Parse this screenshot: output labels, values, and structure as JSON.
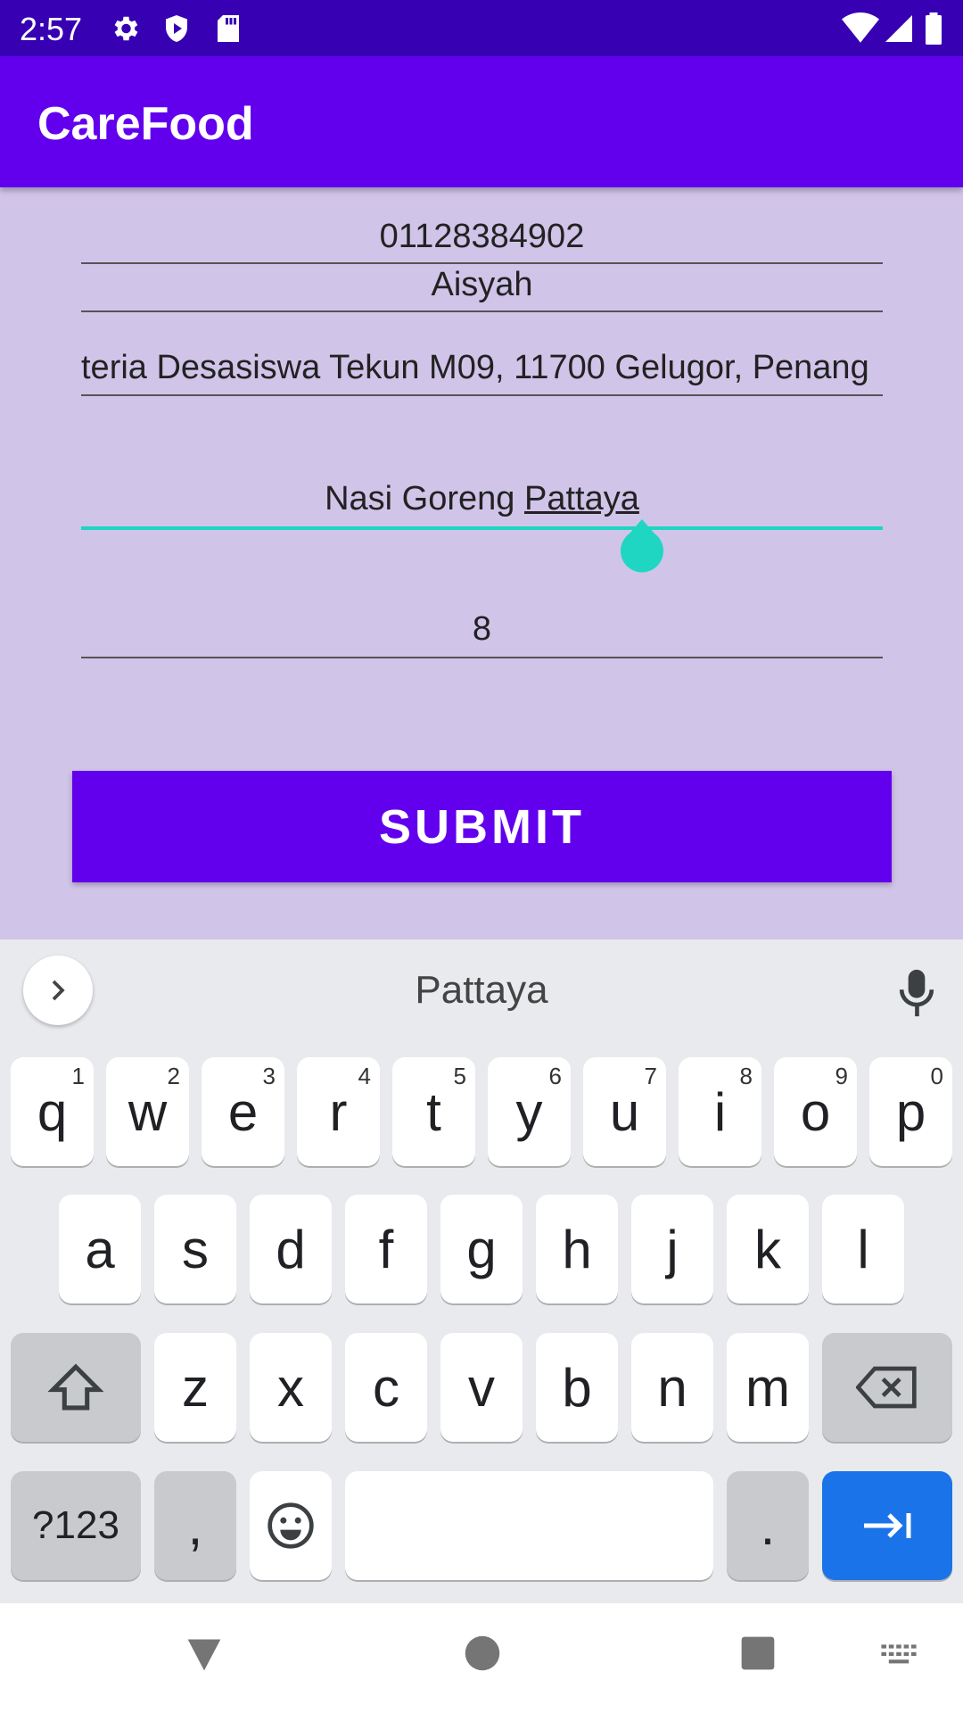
{
  "status_bar": {
    "time": "2:57",
    "icons": [
      "gear-icon",
      "shield-play-icon",
      "sd-card-icon",
      "wifi-icon",
      "signal-icon",
      "battery-icon"
    ]
  },
  "app_bar": {
    "title": "CareFood"
  },
  "form": {
    "phone": "01128384902",
    "name": "Aisyah",
    "address": "teria Desasiswa Tekun M09, 11700 Gelugor, Penang",
    "food_prefix": "Nasi Goreng ",
    "food_underlined": "Pattaya",
    "quantity": "8",
    "submit_label": "SUBMIT"
  },
  "colors": {
    "primary": "#6200ee",
    "primary_dark": "#3700b3",
    "background": "#d1c4e9",
    "accent": "#1ed6c1",
    "action_key": "#1a73e8"
  },
  "keyboard": {
    "suggestion": "Pattaya",
    "row1": [
      {
        "key": "q",
        "hint": "1"
      },
      {
        "key": "w",
        "hint": "2"
      },
      {
        "key": "e",
        "hint": "3"
      },
      {
        "key": "r",
        "hint": "4"
      },
      {
        "key": "t",
        "hint": "5"
      },
      {
        "key": "y",
        "hint": "6"
      },
      {
        "key": "u",
        "hint": "7"
      },
      {
        "key": "i",
        "hint": "8"
      },
      {
        "key": "o",
        "hint": "9"
      },
      {
        "key": "p",
        "hint": "0"
      }
    ],
    "row2": [
      "a",
      "s",
      "d",
      "f",
      "g",
      "h",
      "j",
      "k",
      "l"
    ],
    "row3": [
      "z",
      "x",
      "c",
      "v",
      "b",
      "n",
      "m"
    ],
    "symbols_key": "?123",
    "comma_key": ",",
    "period_key": "."
  }
}
